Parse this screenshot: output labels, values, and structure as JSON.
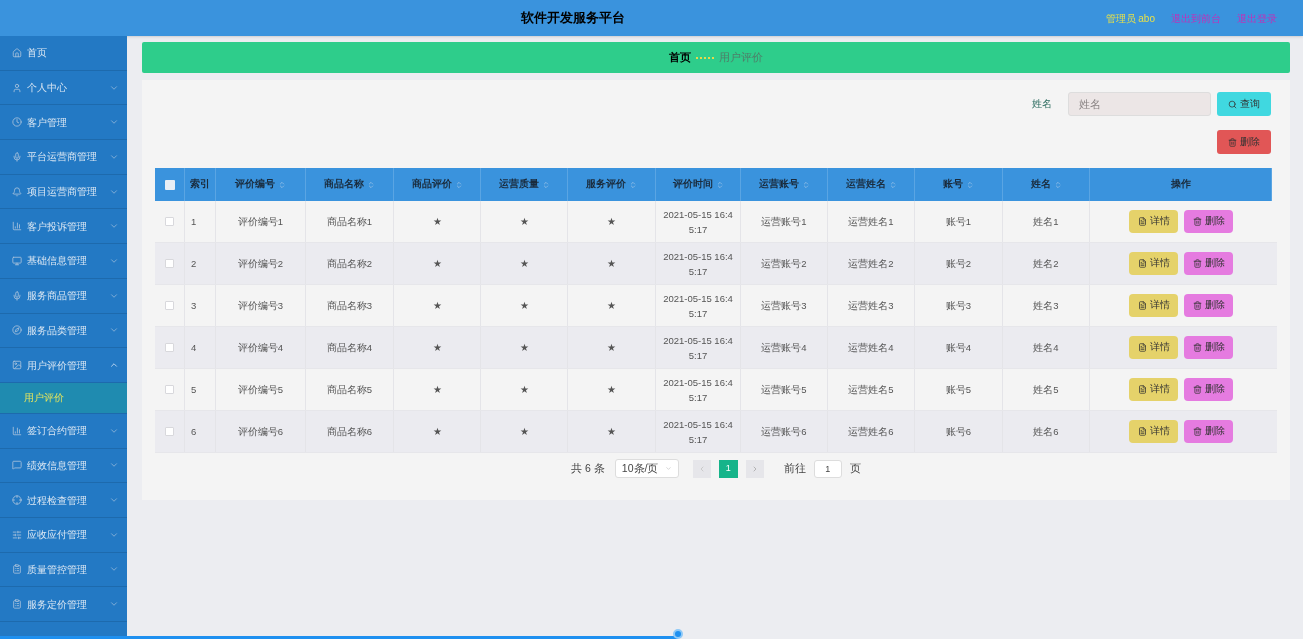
{
  "header": {
    "title": "软件开发服务平台",
    "user": "管理员 abo",
    "links": [
      "退出到前台",
      "退出登录"
    ]
  },
  "sidebar": {
    "items": [
      {
        "label": "首页",
        "kind": "link"
      },
      {
        "label": "个人中心",
        "kind": "group",
        "expanded": false
      },
      {
        "label": "客户管理",
        "kind": "group",
        "expanded": false
      },
      {
        "label": "平台运营商管理",
        "kind": "group",
        "expanded": false
      },
      {
        "label": "项目运营商管理",
        "kind": "group",
        "expanded": false
      },
      {
        "label": "客户投诉管理",
        "kind": "group",
        "expanded": false
      },
      {
        "label": "基础信息管理",
        "kind": "group",
        "expanded": false
      },
      {
        "label": "服务商品管理",
        "kind": "group",
        "expanded": false
      },
      {
        "label": "服务品类管理",
        "kind": "group",
        "expanded": false
      },
      {
        "label": "用户评价管理",
        "kind": "group",
        "expanded": true,
        "children": [
          {
            "label": "用户评价",
            "selected": true
          }
        ]
      },
      {
        "label": "签订合约管理",
        "kind": "group",
        "expanded": false
      },
      {
        "label": "绩效信息管理",
        "kind": "group",
        "expanded": false
      },
      {
        "label": "过程检查管理",
        "kind": "group",
        "expanded": false
      },
      {
        "label": "应收应付管理",
        "kind": "group",
        "expanded": false
      },
      {
        "label": "质量管控管理",
        "kind": "group",
        "expanded": false
      },
      {
        "label": "服务定价管理",
        "kind": "group",
        "expanded": false
      }
    ]
  },
  "breadcrumb": [
    "首页",
    "用户评价"
  ],
  "search": {
    "label": "姓名",
    "placeholder": "姓名",
    "button": "查询"
  },
  "bulk_delete": "删除",
  "table": {
    "select_all_checked": false,
    "columns": [
      "索引",
      "评价编号",
      "商品名称",
      "商品评价",
      "运营质量",
      "服务评价",
      "评价时间",
      "运营账号",
      "运营姓名",
      "账号",
      "姓名",
      "操作"
    ],
    "rows": [
      {
        "checked": false,
        "cells": [
          "1",
          "评价编号1",
          "商品名称1",
          "★",
          "★",
          "★",
          "2021-05-15 16:45:17",
          "运营账号1",
          "运营姓名1",
          "账号1",
          "姓名1"
        ],
        "actions": [
          "详情",
          "删除"
        ]
      },
      {
        "checked": false,
        "cells": [
          "2",
          "评价编号2",
          "商品名称2",
          "★",
          "★",
          "★",
          "2021-05-15 16:45:17",
          "运营账号2",
          "运营姓名2",
          "账号2",
          "姓名2"
        ],
        "actions": [
          "详情",
          "删除"
        ]
      },
      {
        "checked": false,
        "cells": [
          "3",
          "评价编号3",
          "商品名称3",
          "★",
          "★",
          "★",
          "2021-05-15 16:45:17",
          "运营账号3",
          "运营姓名3",
          "账号3",
          "姓名3"
        ],
        "actions": [
          "详情",
          "删除"
        ]
      },
      {
        "checked": false,
        "cells": [
          "4",
          "评价编号4",
          "商品名称4",
          "★",
          "★",
          "★",
          "2021-05-15 16:45:17",
          "运营账号4",
          "运营姓名4",
          "账号4",
          "姓名4"
        ],
        "actions": [
          "详情",
          "删除"
        ]
      },
      {
        "checked": false,
        "cells": [
          "5",
          "评价编号5",
          "商品名称5",
          "★",
          "★",
          "★",
          "2021-05-15 16:45:17",
          "运营账号5",
          "运营姓名5",
          "账号5",
          "姓名5"
        ],
        "actions": [
          "详情",
          "删除"
        ]
      },
      {
        "checked": false,
        "cells": [
          "6",
          "评价编号6",
          "商品名称6",
          "★",
          "★",
          "★",
          "2021-05-15 16:45:17",
          "运营账号6",
          "运营姓名6",
          "账号6",
          "姓名6"
        ],
        "actions": [
          "详情",
          "删除"
        ]
      }
    ]
  },
  "pagination": {
    "total": "共 6 条",
    "page_size": "10条/页",
    "pages": [
      {
        "label": "1",
        "selected": true
      }
    ],
    "goto_label": "前往",
    "goto_value": "1",
    "goto_suffix": "页"
  },
  "video_progress": {
    "level": 0.52
  }
}
